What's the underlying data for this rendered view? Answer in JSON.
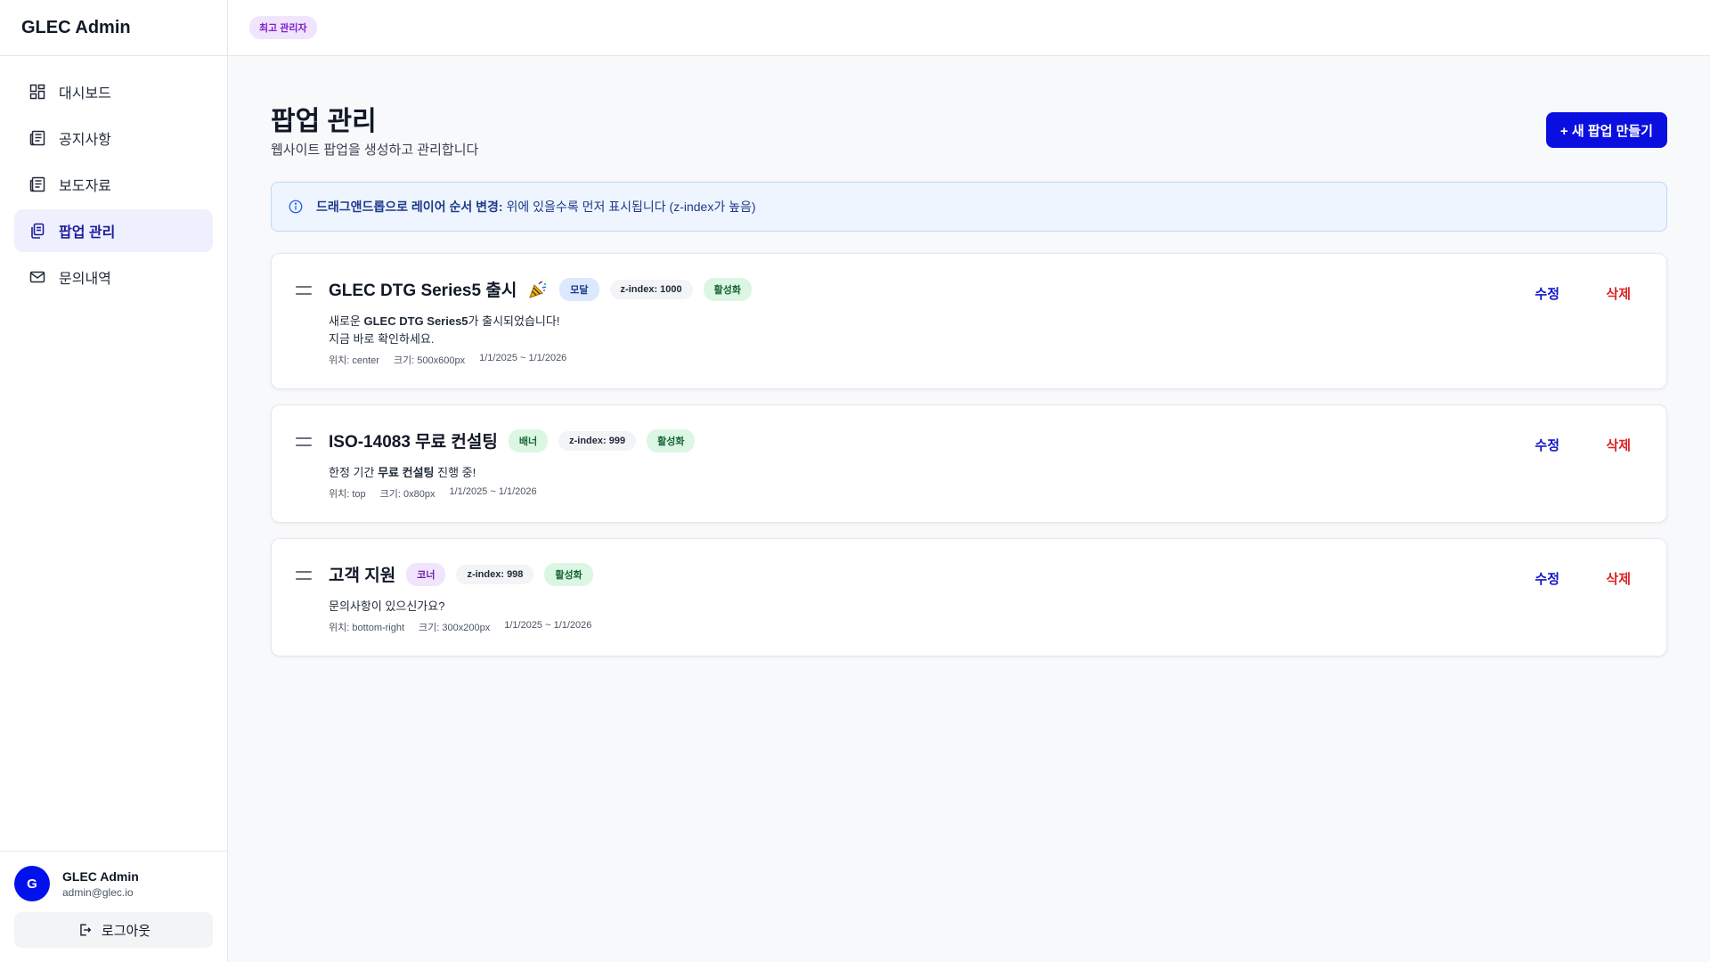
{
  "app": {
    "brand": "GLEC Admin",
    "role_badge": "최고 관리자"
  },
  "sidebar": {
    "items": [
      {
        "label": "대시보드",
        "icon": "dashboard-icon"
      },
      {
        "label": "공지사항",
        "icon": "newspaper-icon"
      },
      {
        "label": "보도자료",
        "icon": "newspaper-icon"
      },
      {
        "label": "팝업 관리",
        "icon": "copy-icon",
        "active": true
      },
      {
        "label": "문의내역",
        "icon": "mail-icon"
      }
    ],
    "user": {
      "initial": "G",
      "name": "GLEC Admin",
      "email": "admin@glec.io"
    },
    "logout_label": "로그아웃"
  },
  "page": {
    "title": "팝업 관리",
    "subtitle": "웹사이트 팝업을 생성하고 관리합니다",
    "create_button": "+ 새 팝업 만들기",
    "info": {
      "strong": "드래그앤드롭으로 레이어 순서 변경:",
      "text": "위에 있을수록 먼저 표시됩니다 (z-index가 높음)"
    }
  },
  "popups": [
    {
      "title": "GLEC DTG Series5 출시",
      "type": "모달",
      "zindex": "z-index: 1000",
      "status": "활성화",
      "line1_pre": "새로운 ",
      "line1_strong": "GLEC DTG Series5",
      "line1_post": "가 출시되었습니다!",
      "line2": "지금 바로 확인하세요.",
      "position": "위치: center",
      "size": "크기: 500x600px",
      "dates": "1/1/2025 ~ 1/1/2026",
      "edit": "수정",
      "delete": "삭제"
    },
    {
      "title": "ISO-14083 무료 컨설팅",
      "type": "배너",
      "zindex": "z-index: 999",
      "status": "활성화",
      "line1_pre": "한정 기간 ",
      "line1_strong": "무료 컨설팅",
      "line1_post": " 진행 중!",
      "position": "위치: top",
      "size": "크기: 0x80px",
      "dates": "1/1/2025 ~ 1/1/2026",
      "edit": "수정",
      "delete": "삭제"
    },
    {
      "title": "고객 지원",
      "type": "코너",
      "zindex": "z-index: 998",
      "status": "활성화",
      "line1": "문의사항이 있으신가요?",
      "position": "위치: bottom-right",
      "size": "크기: 300x200px",
      "dates": "1/1/2025 ~ 1/1/2026",
      "edit": "수정",
      "delete": "삭제"
    }
  ],
  "colors": {
    "primary": "#0a0fe0",
    "danger": "#dc2626",
    "active_nav_bg": "#eef0fe"
  }
}
